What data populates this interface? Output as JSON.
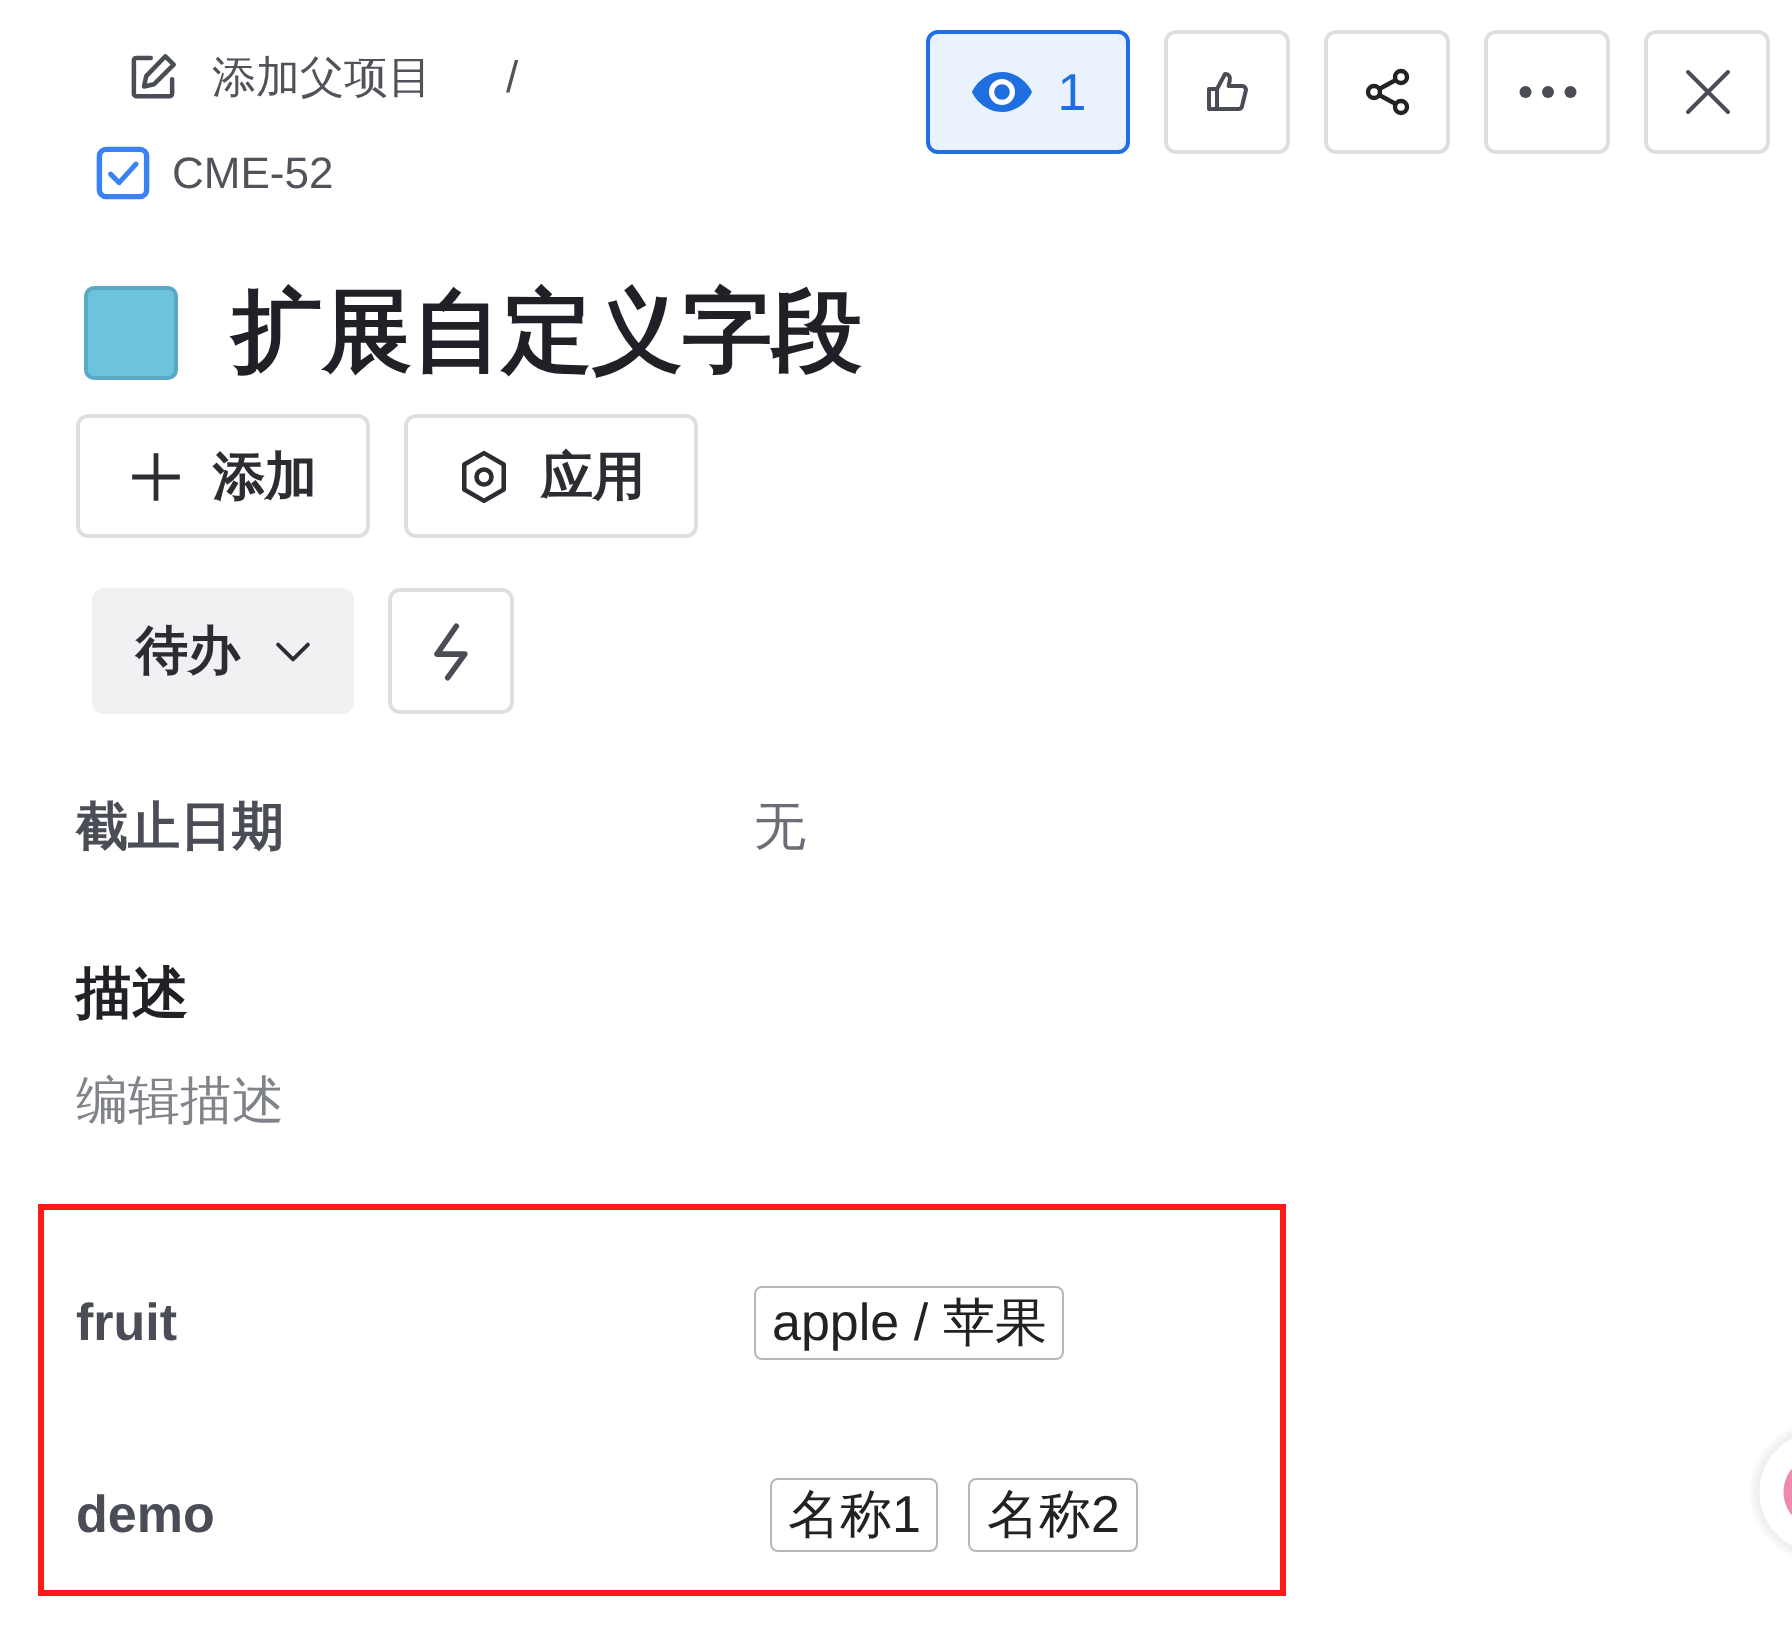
{
  "breadcrumb": {
    "parent_link": "添加父项目",
    "separator": "/",
    "issue_key": "CME-52"
  },
  "toolbar": [
    {
      "kind": "watch",
      "label": "1",
      "active": true
    },
    {
      "kind": "like",
      "active": false
    },
    {
      "kind": "share",
      "active": false
    },
    {
      "kind": "more",
      "active": false
    },
    {
      "kind": "close",
      "active": false
    }
  ],
  "title": "扩展自定义字段",
  "actions": [
    {
      "kind": "add",
      "label": "添加"
    },
    {
      "kind": "apply",
      "label": "应用"
    }
  ],
  "status": {
    "label": "待办"
  },
  "fields": [
    {
      "label": "截止日期",
      "value": "无"
    }
  ],
  "description": {
    "heading": "描述",
    "edit_link": "编辑描述"
  },
  "custom_fields": [
    {
      "label": "fruit",
      "kind": "single",
      "values": [
        "apple / 苹果"
      ]
    },
    {
      "label": "demo",
      "kind": "multi",
      "values": [
        "名称1",
        "名称2"
      ]
    }
  ]
}
